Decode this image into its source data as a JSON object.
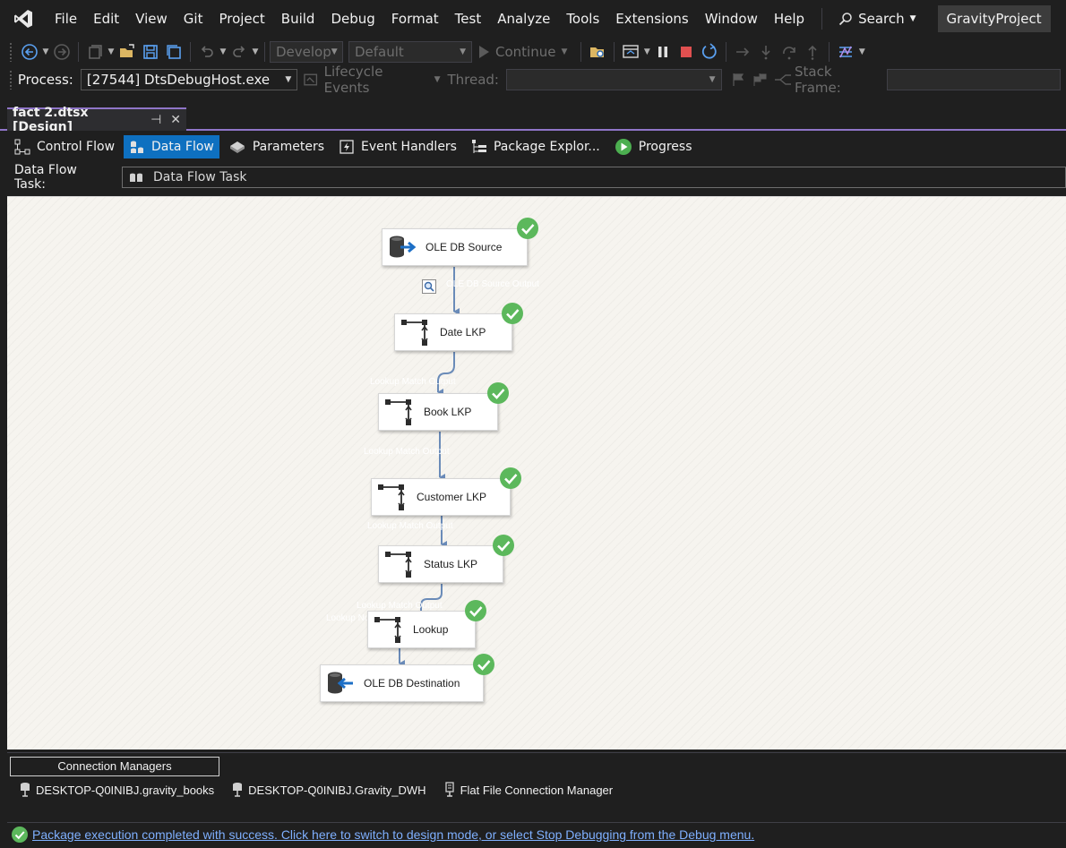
{
  "menu": {
    "items": [
      "File",
      "Edit",
      "View",
      "Git",
      "Project",
      "Build",
      "Debug",
      "Format",
      "Test",
      "Analyze",
      "Tools",
      "Extensions",
      "Window",
      "Help"
    ],
    "search_label": "Search",
    "project_name": "GravityProject"
  },
  "toolbar": {
    "configuration": "Develop",
    "platform": "Default",
    "continue_label": "Continue"
  },
  "debug_toolbar": {
    "process_label": "Process:",
    "process_value": "[27544] DtsDebugHost.exe",
    "lifecycle_label": "Lifecycle Events",
    "thread_label": "Thread:",
    "stack_frame_label": "Stack Frame:"
  },
  "document_tab": {
    "title": "fact 2.dtsx [Design]"
  },
  "designer_tabs": [
    {
      "label": "Control Flow",
      "icon": "control-flow-icon"
    },
    {
      "label": "Data Flow",
      "icon": "data-flow-icon",
      "active": true
    },
    {
      "label": "Parameters",
      "icon": "parameters-icon"
    },
    {
      "label": "Event Handlers",
      "icon": "event-handlers-icon"
    },
    {
      "label": "Package Explor...",
      "icon": "package-explorer-icon"
    },
    {
      "label": "Progress",
      "icon": "progress-icon"
    }
  ],
  "task_bar": {
    "label": "Data Flow Task:",
    "value": "Data Flow Task"
  },
  "components": {
    "source": "OLE DB Source",
    "date_lkp": "Date LKP",
    "book_lkp": "Book LKP",
    "customer_lkp": "Customer LKP",
    "status_lkp": "Status LKP",
    "lookup": "Lookup",
    "destination": "OLE DB Destination"
  },
  "connection_managers": {
    "title": "Connection Managers",
    "items": [
      {
        "label": "DESKTOP-Q0INIBJ.gravity_books",
        "icon": "db-connection-icon"
      },
      {
        "label": "DESKTOP-Q0INIBJ.Gravity_DWH",
        "icon": "db-connection-icon"
      },
      {
        "label": "Flat File Connection Manager",
        "icon": "flat-file-icon"
      }
    ]
  },
  "status": {
    "message": "Package execution completed with success. Click here to switch to design mode, or select Stop Debugging from the Debug menu."
  },
  "colors": {
    "accent": "#8f75c8",
    "active_tab": "#0e70c0",
    "success": "#5cb85c",
    "connector": "#6a8bb8"
  }
}
